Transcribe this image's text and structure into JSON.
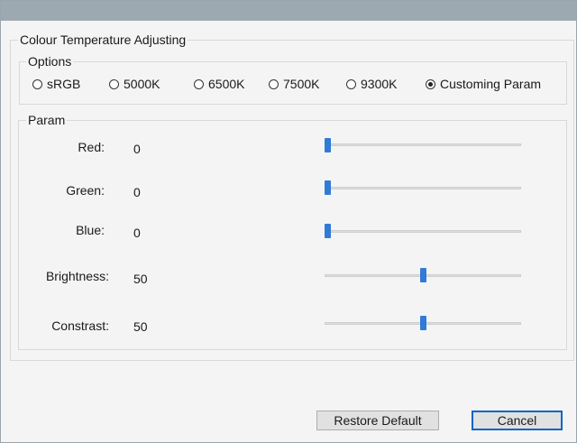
{
  "group_title": "Colour Temperature Adjusting",
  "options": {
    "title": "Options",
    "radios": [
      {
        "label": "sRGB",
        "checked": false
      },
      {
        "label": "5000K",
        "checked": false
      },
      {
        "label": "6500K",
        "checked": false
      },
      {
        "label": "7500K",
        "checked": false
      },
      {
        "label": "9300K",
        "checked": false
      },
      {
        "label": "Customing Param",
        "checked": true
      }
    ]
  },
  "param": {
    "title": "Param",
    "sliders": [
      {
        "label": "Red:",
        "value": "0",
        "level": 0
      },
      {
        "label": "Green:",
        "value": "0",
        "level": 0
      },
      {
        "label": "Blue:",
        "value": "0",
        "level": 0
      },
      {
        "label": "Brightness:",
        "value": "50",
        "level": 0.5
      },
      {
        "label": "Constrast:",
        "value": "50",
        "level": 0.5
      }
    ]
  },
  "buttons": {
    "restore_label": "Restore Default",
    "cancel_label": "Cancel"
  }
}
